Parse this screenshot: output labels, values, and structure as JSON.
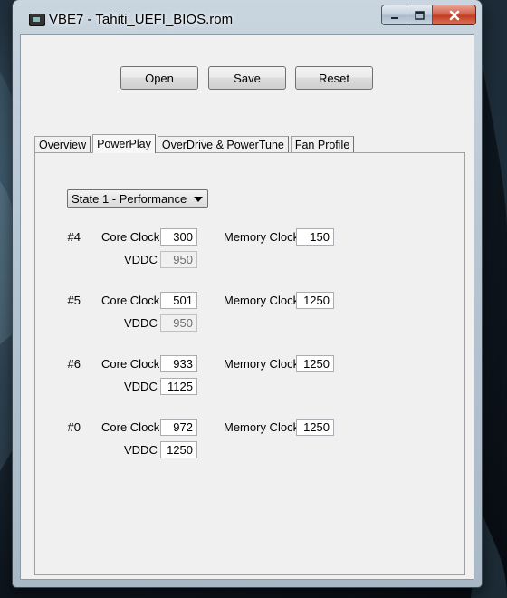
{
  "window": {
    "title": "VBE7 - Tahiti_UEFI_BIOS.rom"
  },
  "toolbar": {
    "open_label": "Open",
    "save_label": "Save",
    "reset_label": "Reset"
  },
  "tabs": [
    {
      "label": "Overview",
      "active": false
    },
    {
      "label": "PowerPlay",
      "active": true
    },
    {
      "label": "OverDrive & PowerTune",
      "active": false
    },
    {
      "label": "Fan Profile",
      "active": false
    }
  ],
  "powerplay": {
    "state_selected": "State 1 - Performance",
    "core_clock_label": "Core Clock",
    "memory_clock_label": "Memory Clock",
    "vddc_label": "VDDC",
    "entries": [
      {
        "index": "#4",
        "core_clock": "300",
        "memory_clock": "150",
        "vddc": "950",
        "vddc_enabled": false
      },
      {
        "index": "#5",
        "core_clock": "501",
        "memory_clock": "1250",
        "vddc": "950",
        "vddc_enabled": false
      },
      {
        "index": "#6",
        "core_clock": "933",
        "memory_clock": "1250",
        "vddc": "1125",
        "vddc_enabled": true
      },
      {
        "index": "#0",
        "core_clock": "972",
        "memory_clock": "1250",
        "vddc": "1250",
        "vddc_enabled": true
      }
    ]
  },
  "icons": {
    "app": "app-icon",
    "minimize": "minimize-icon",
    "maximize": "maximize-icon",
    "close": "close-icon",
    "dropdown": "chevron-down-icon"
  },
  "colors": {
    "window_frame": "#b8c6d2",
    "client_bg": "#f0f0f0",
    "close_button": "#c0391f"
  }
}
